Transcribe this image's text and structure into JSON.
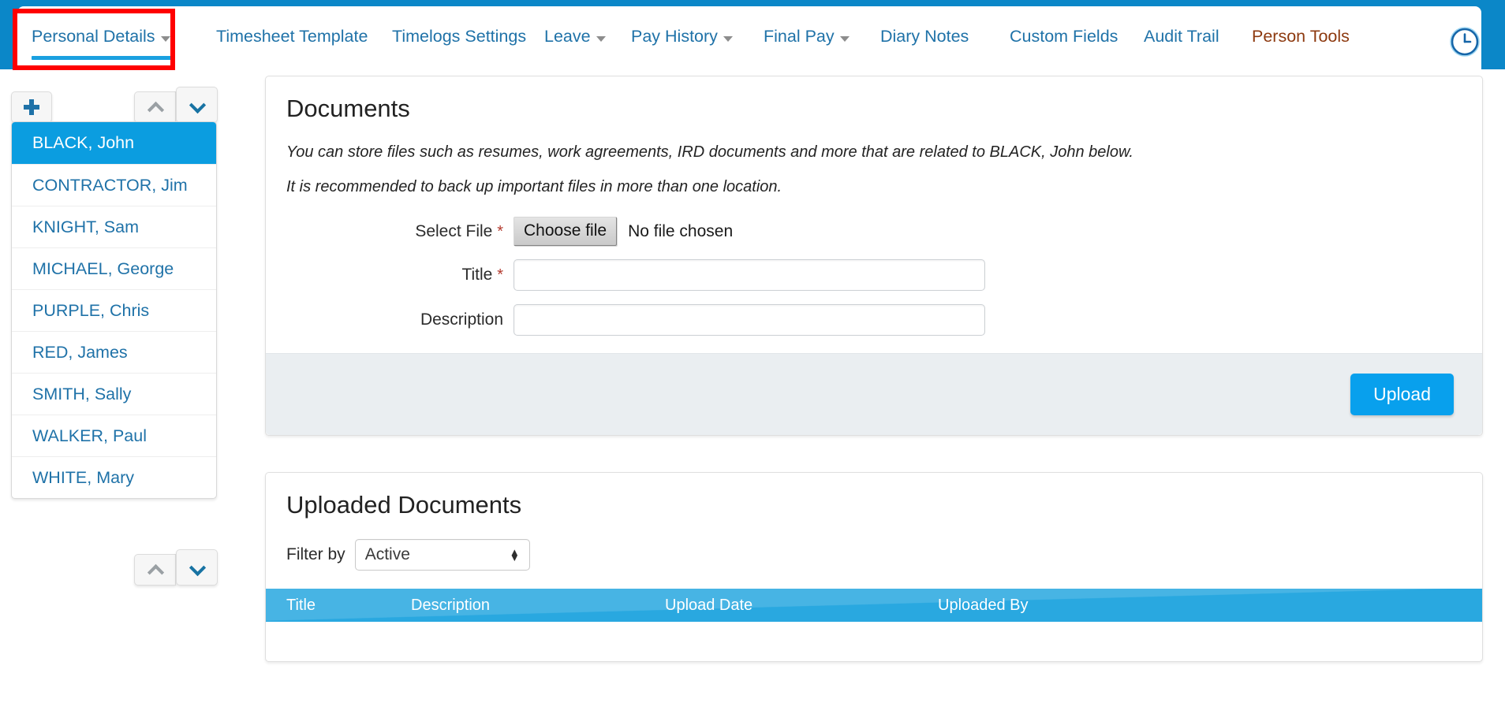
{
  "theme": {
    "brand_blue": "#0b87c8",
    "accent_blue": "#08a0ed",
    "link_blue": "#1f72a8",
    "selected_blue": "#0b9de0",
    "table_header_blue": "#29a8e0",
    "person_tools_brown": "#8d3a10",
    "highlight_red": "#ff0000",
    "footer_gray": "#eaeef1"
  },
  "nav": {
    "tabs": [
      {
        "label": "Personal Details",
        "caret": true,
        "active": true,
        "style": "link"
      },
      {
        "label": "Timesheet Template",
        "caret": false,
        "active": false,
        "style": "link"
      },
      {
        "label": "Timelogs Settings",
        "caret": false,
        "active": false,
        "style": "link"
      },
      {
        "label": "Leave",
        "caret": true,
        "active": false,
        "style": "link"
      },
      {
        "label": "Pay History",
        "caret": true,
        "active": false,
        "style": "link"
      },
      {
        "label": "Final Pay",
        "caret": true,
        "active": false,
        "style": "link"
      },
      {
        "label": "Diary Notes",
        "caret": false,
        "active": false,
        "style": "link"
      },
      {
        "label": "Custom Fields",
        "caret": false,
        "active": false,
        "style": "link"
      },
      {
        "label": "Audit Trail",
        "caret": false,
        "active": false,
        "style": "link"
      },
      {
        "label": "Person Tools",
        "caret": false,
        "active": false,
        "style": "brown"
      }
    ],
    "clock_icon": "clock-icon"
  },
  "sidebar": {
    "add_button_icon": "plus-icon",
    "top_prev_icon": "chevron-up-icon",
    "top_next_icon": "chevron-down-icon",
    "bottom_prev_icon": "chevron-up-icon",
    "bottom_next_icon": "chevron-down-icon",
    "people": [
      {
        "name": "BLACK, John",
        "selected": true
      },
      {
        "name": "CONTRACTOR, Jim",
        "selected": false
      },
      {
        "name": "KNIGHT, Sam",
        "selected": false
      },
      {
        "name": "MICHAEL, George",
        "selected": false
      },
      {
        "name": "PURPLE, Chris",
        "selected": false
      },
      {
        "name": "RED, James",
        "selected": false
      },
      {
        "name": "SMITH, Sally",
        "selected": false
      },
      {
        "name": "WALKER, Paul",
        "selected": false
      },
      {
        "name": "WHITE, Mary",
        "selected": false
      }
    ]
  },
  "documents_panel": {
    "title": "Documents",
    "hint_1": "You can store files such as resumes, work agreements, IRD documents and more that are related to BLACK, John below.",
    "hint_2": "It is recommended to back up important files in more than one location.",
    "select_file_label": "Select File",
    "select_file_required": "*",
    "choose_file_button": "Choose file",
    "no_file_chosen": "No file chosen",
    "title_label": "Title",
    "title_required": "*",
    "title_value": "",
    "title_placeholder": "",
    "description_label": "Description",
    "description_value": "",
    "description_placeholder": "",
    "upload_button": "Upload"
  },
  "uploaded_panel": {
    "title": "Uploaded Documents",
    "filter_label": "Filter by",
    "filter_selected": "Active",
    "filter_options": [
      "Active"
    ],
    "columns": [
      "Title",
      "Description",
      "Upload Date",
      "Uploaded By"
    ],
    "rows": []
  }
}
